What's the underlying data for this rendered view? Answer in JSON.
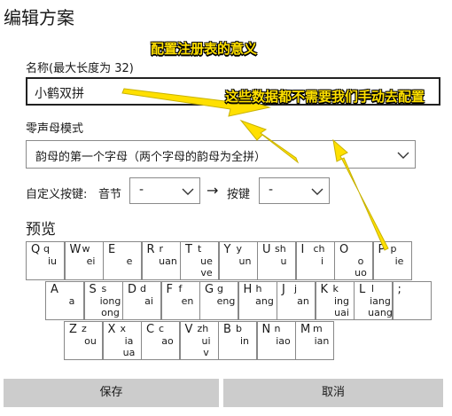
{
  "title": "编辑方案",
  "name_label": "名称(最大长度为 32)",
  "name_value": "小鹤双拼",
  "zero_label": "零声母模式",
  "zero_value": "韵母的第一个字母（两个字母的韵母为全拼）",
  "custom_label": "自定义按键:",
  "syllable_label": "音节",
  "syllable_value": "-",
  "arrow": "→",
  "key_label": "按键",
  "key_value": "-",
  "preview_label": "预览",
  "annotations": {
    "a1": "配置注册表的意义",
    "a2": "这些数据都不需要我们手动去配置"
  },
  "colors": {
    "annotation": "#ffe000",
    "button": "#cccccc"
  },
  "keys": [
    {
      "k": "Q",
      "t": "q",
      "b": "iu"
    },
    {
      "k": "W",
      "t": "w",
      "b": "ei"
    },
    {
      "k": "E",
      "t": "",
      "b": "e"
    },
    {
      "k": "R",
      "t": "r",
      "b": "uan"
    },
    {
      "k": "T",
      "t": "t",
      "b": "ue\nve"
    },
    {
      "k": "Y",
      "t": "y",
      "b": "un"
    },
    {
      "k": "U",
      "t": "sh",
      "b": "u"
    },
    {
      "k": "I",
      "t": "ch",
      "b": "i"
    },
    {
      "k": "O",
      "t": "",
      "b": "o\nuo"
    },
    {
      "k": "P",
      "t": "p",
      "b": "ie"
    },
    {
      "k": "A",
      "t": "",
      "b": "a"
    },
    {
      "k": "S",
      "t": "s",
      "b": "iong\nong"
    },
    {
      "k": "D",
      "t": "d",
      "b": "ai"
    },
    {
      "k": "F",
      "t": "f",
      "b": "en"
    },
    {
      "k": "G",
      "t": "g",
      "b": "eng"
    },
    {
      "k": "H",
      "t": "h",
      "b": "ang"
    },
    {
      "k": "J",
      "t": "j",
      "b": "an"
    },
    {
      "k": "K",
      "t": "k",
      "b": "ing\nuai"
    },
    {
      "k": "L",
      "t": "l",
      "b": "iang\nuang"
    },
    {
      "k": ";",
      "t": "",
      "b": ""
    },
    {
      "k": "Z",
      "t": "z",
      "b": "ou"
    },
    {
      "k": "X",
      "t": "x",
      "b": "ia\nua"
    },
    {
      "k": "C",
      "t": "c",
      "b": "ao"
    },
    {
      "k": "V",
      "t": "zh",
      "b": "ui\nv"
    },
    {
      "k": "B",
      "t": "b",
      "b": "in"
    },
    {
      "k": "N",
      "t": "n",
      "b": "iao"
    },
    {
      "k": "M",
      "t": "m",
      "b": "ian"
    }
  ],
  "save_label": "保存",
  "cancel_label": "取消"
}
